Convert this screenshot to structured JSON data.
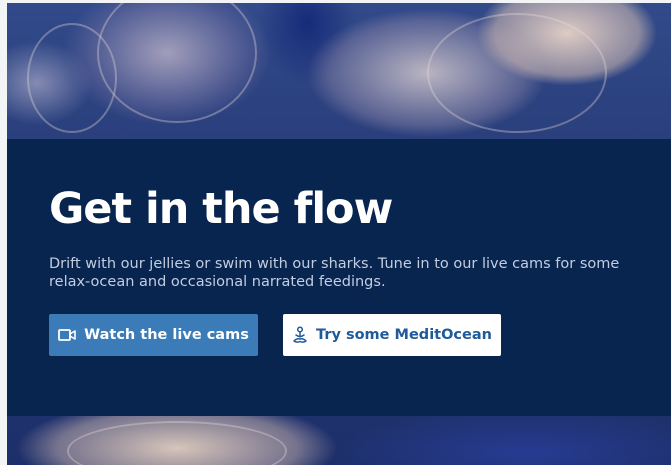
{
  "hero": {
    "headline": "Get in the flow",
    "description": "Drift with our jellies or swim with our sharks. Tune in to our live cams for some relax-ocean and occasional narrated feedings.",
    "primary_button": {
      "label": "Watch the live cams",
      "icon": "video-camera-icon"
    },
    "secondary_button": {
      "label": "Try some MeditOcean",
      "icon": "meditation-person-icon"
    }
  },
  "colors": {
    "panel_bg": "#08254f",
    "primary_button_bg": "#3b7cb8",
    "secondary_button_text": "#1f5a99"
  }
}
